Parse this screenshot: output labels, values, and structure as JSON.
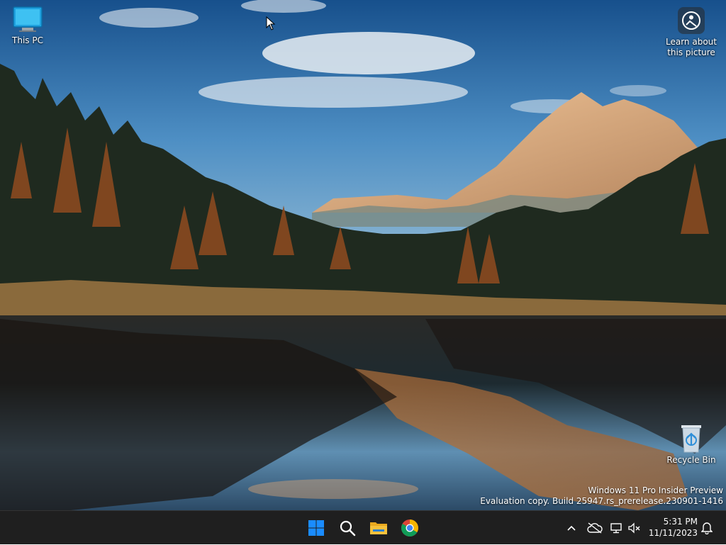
{
  "desktop": {
    "icons": [
      {
        "label": "This PC"
      },
      {
        "label": "Learn about this picture"
      },
      {
        "label": "Recycle Bin"
      }
    ],
    "watermark": {
      "line1": "Windows 11 Pro Insider Preview",
      "line2": "Evaluation copy. Build 25947.rs_prerelease.230901-1416"
    }
  },
  "taskbar": {
    "apps": [
      {
        "icon": "windows-start-icon"
      },
      {
        "icon": "search-icon"
      },
      {
        "icon": "file-explorer-icon"
      },
      {
        "icon": "chrome-icon"
      }
    ],
    "tray": {
      "icons": [
        "chevron-up-icon",
        "cloud-offline-icon",
        "network-icon",
        "volume-muted-icon",
        "notification-bell-icon"
      ]
    },
    "clock": {
      "time": "5:31 PM",
      "date": "11/11/2023"
    }
  },
  "colors": {
    "taskbar_bg": "#1f1f1f",
    "windows_blue": "#1a8cff",
    "sky_top": "#1f5f9e",
    "explorer_yellow": "#f5c13c"
  }
}
